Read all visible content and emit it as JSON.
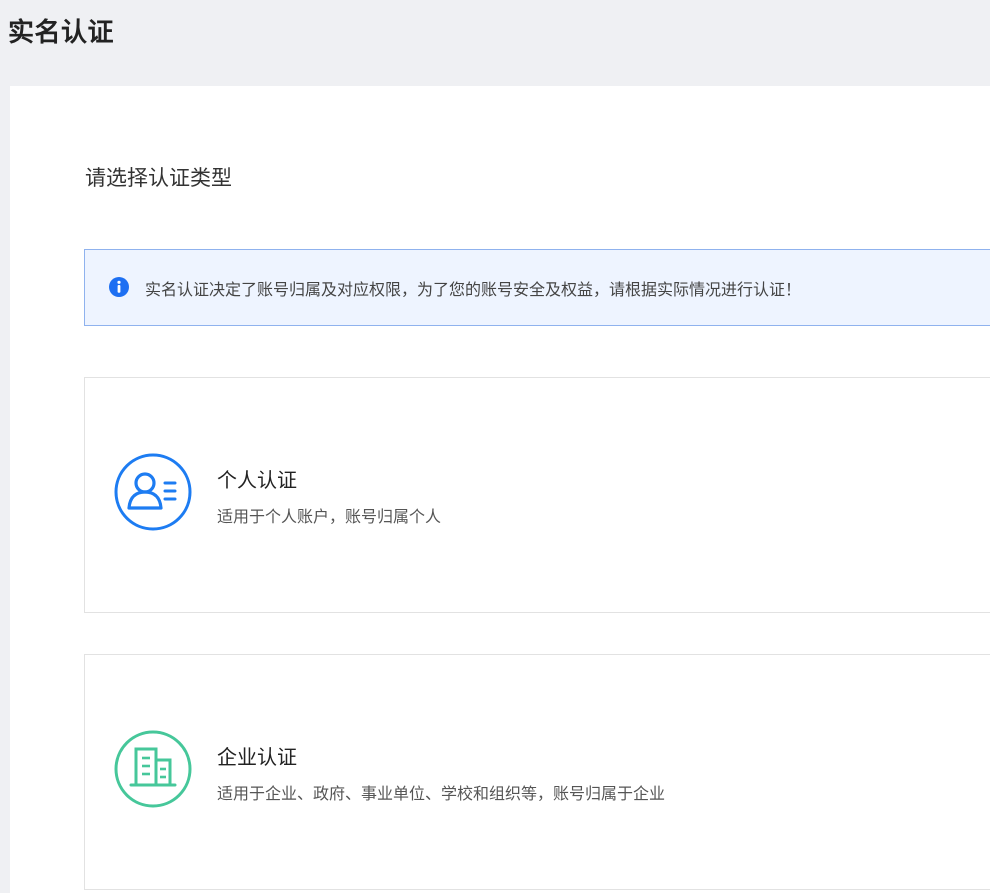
{
  "header": {
    "title": "实名认证"
  },
  "main": {
    "section_title": "请选择认证类型",
    "notice": {
      "icon": "info-icon",
      "text": "实名认证决定了账号归属及对应权限，为了您的账号安全及权益，请根据实际情况进行认证！"
    },
    "options": [
      {
        "icon": "person-icon",
        "color": "#1d7cf2",
        "title": "个人认证",
        "description": "适用于个人账户，账号归属个人"
      },
      {
        "icon": "building-icon",
        "color": "#46c79a",
        "title": "企业认证",
        "description": "适用于企业、政府、事业单位、学校和组织等，账号归属于企业"
      }
    ]
  }
}
